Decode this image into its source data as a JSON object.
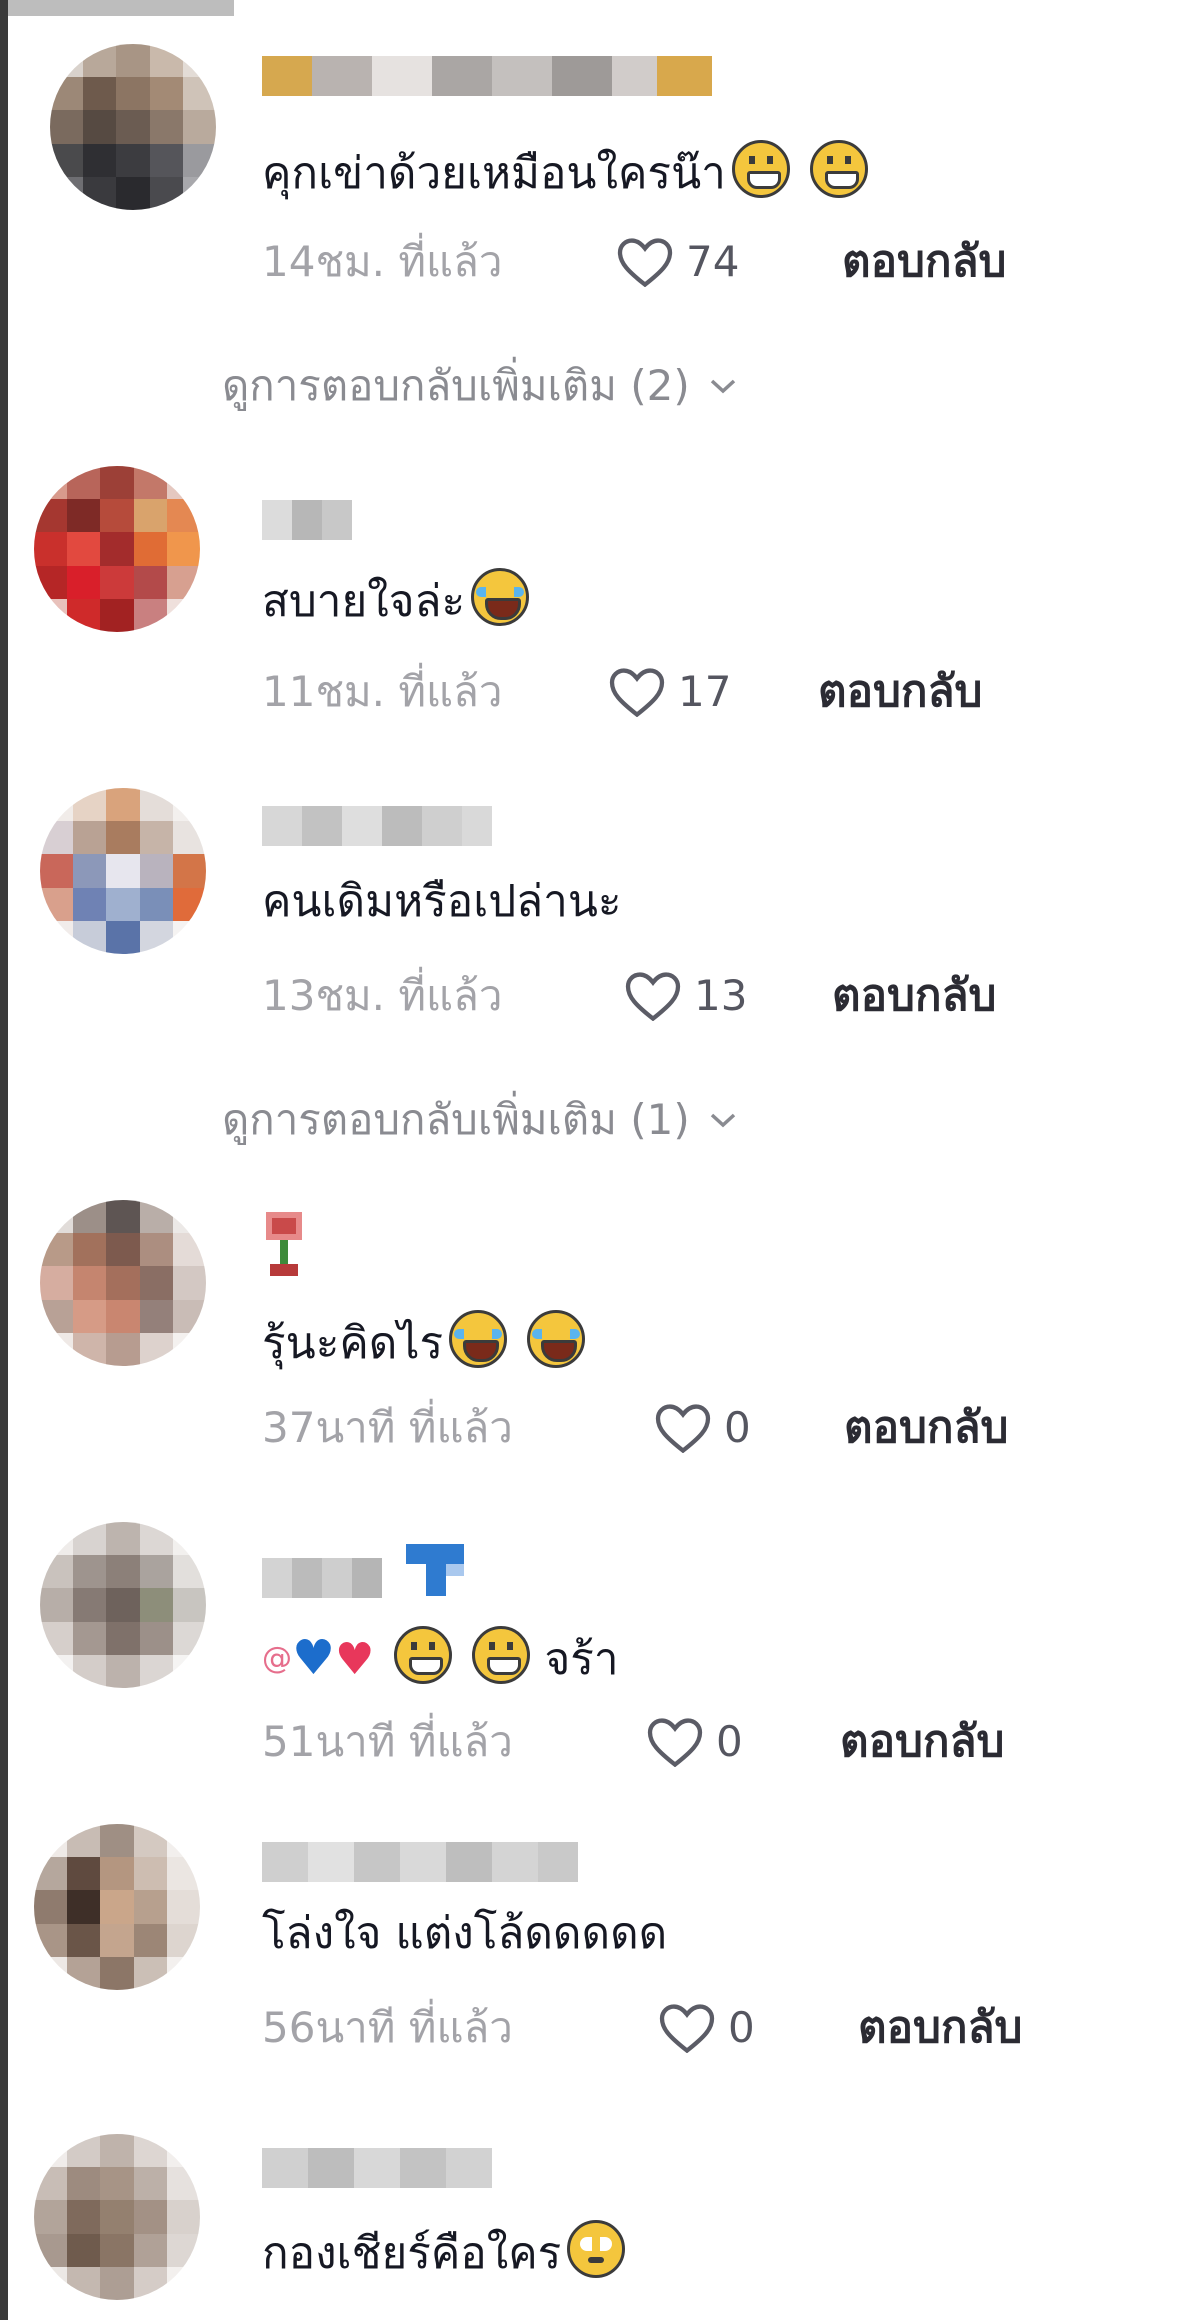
{
  "comments": [
    {
      "text": "คุกเข่าด้วยเหมือนใครน๊า",
      "emojis": [
        "grinning-face-with-smiling-eyes",
        "grinning-face-with-smiling-eyes"
      ],
      "time": "14ชม. ที่แล้ว",
      "likes": "74",
      "reply": "ตอบกลับ",
      "view_replies": "ดูการตอบกลับเพิ่มเติม (2)"
    },
    {
      "text": "สบายใจล่ะ",
      "emojis": [
        "face-with-tears-of-joy"
      ],
      "time": "11ชม. ที่แล้ว",
      "likes": "17",
      "reply": "ตอบกลับ"
    },
    {
      "text": "คนเดิมหรือเปล่านะ",
      "emojis": [],
      "time": "13ชม. ที่แล้ว",
      "likes": "13",
      "reply": "ตอบกลับ",
      "view_replies": "ดูการตอบกลับเพิ่มเติม (1)"
    },
    {
      "text": "รุ้นะคิดไร",
      "emojis": [
        "face-with-tears-of-joy",
        "face-with-tears-of-joy"
      ],
      "time": "37นาที ที่แล้ว",
      "likes": "0",
      "reply": "ตอบกลับ"
    },
    {
      "mention": "@",
      "text": "จร้า",
      "emojis": [
        "blue-heart",
        "red-heart",
        "grinning-face-with-smiling-eyes",
        "grinning-face-with-smiling-eyes"
      ],
      "time": "51นาที ที่แล้ว",
      "likes": "0",
      "reply": "ตอบกลับ"
    },
    {
      "text": "โล่งใจ แต่งโล้ดดดดด",
      "emojis": [],
      "time": "56นาที ที่แล้ว",
      "likes": "0",
      "reply": "ตอบกลับ"
    },
    {
      "text": "กองเชียร์คือใคร",
      "emojis": [
        "flushed-face"
      ]
    }
  ],
  "icons": {
    "like": "heart-outline-icon",
    "expand": "chevron-down-icon"
  },
  "colors": {
    "text": "#161823",
    "muted": "#a3a3a8",
    "reply": "#2b2b33"
  }
}
